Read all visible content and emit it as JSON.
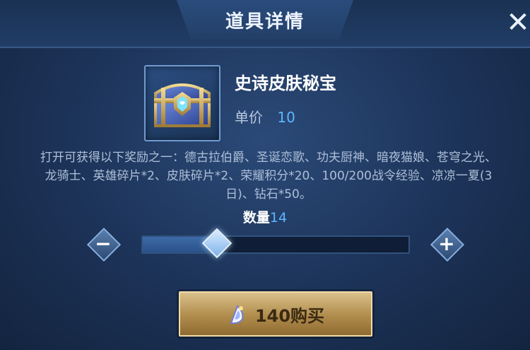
{
  "header": {
    "title": "道具详情",
    "close_glyph": "✕"
  },
  "item": {
    "icon": "treasure-chest-icon",
    "name": "史诗皮肤秘宝",
    "price_label": "单价",
    "price_value": "10"
  },
  "description": "打开可获得以下奖励之一：德古拉伯爵、圣诞恋歌、功夫厨神、暗夜猫娘、苍穹之光、龙骑士、英雄碎片*2、皮肤碎片*2、荣耀积分*20、100/200战令经验、凉凉一夏(3日)、钻石*50。",
  "quantity": {
    "label": "数量",
    "value": "14",
    "slider_fraction": 0.28,
    "minus_glyph": "−",
    "plus_glyph": "+"
  },
  "buy_button": {
    "icon": "coupon-icon",
    "label": "140购买"
  },
  "colors": {
    "accent_blue": "#5db7ff",
    "gold_button": "#c9a866",
    "background": "#1c3257"
  }
}
